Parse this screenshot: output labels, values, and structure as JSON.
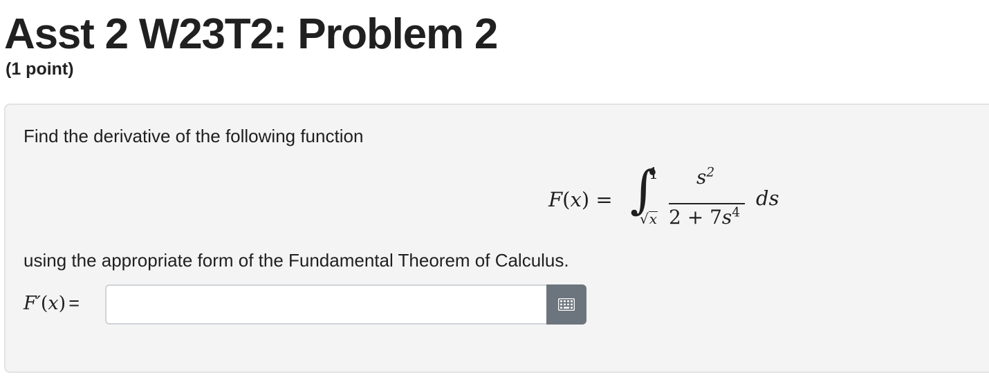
{
  "header": {
    "title": "Asst 2 W23T2: Problem 2",
    "points": "(1 point)"
  },
  "problem": {
    "instruction_line1": "Find the derivative of the following function",
    "instruction_line2": "using the appropriate form of the Fundamental Theorem of Calculus.",
    "formula": {
      "function_name": "F",
      "variable": "x",
      "integral_symbol": "∫",
      "upper_limit": "1",
      "lower_limit_variable": "x",
      "numerator_base": "s",
      "numerator_exponent": "2",
      "denominator_constant": "2 + 7",
      "denominator_base": "s",
      "denominator_exponent": "4",
      "differential": "ds"
    }
  },
  "answer": {
    "label_function": "F",
    "label_prime": "′",
    "label_variable": "x",
    "label_equals": "=",
    "input_value": "",
    "input_placeholder": "",
    "keypad_icon": "keypad-grid-icon"
  },
  "colors": {
    "box_background": "#f4f4f4",
    "keypad_button": "#6c757d"
  }
}
